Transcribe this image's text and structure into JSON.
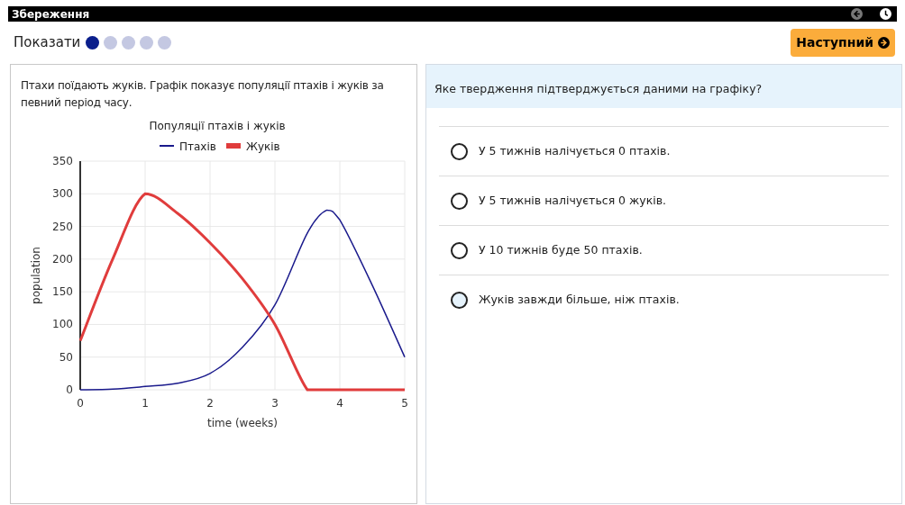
{
  "window": {
    "title": "Збереження"
  },
  "toolbar": {
    "show_label": "Показати",
    "progress": [
      {
        "selected": true
      },
      {
        "selected": false
      },
      {
        "selected": false
      },
      {
        "selected": false
      },
      {
        "selected": false
      }
    ],
    "next_button": "Наступний"
  },
  "passage": {
    "text": "Птахи поїдають жуків. Графік показує популяції птахів і жуків за певний період часу.",
    "chart_data": {
      "type": "line",
      "title": "Популяції птахів і жуків",
      "xlabel": "time (weeks)",
      "ylabel": "population",
      "x": [
        0,
        0.5,
        1,
        1.5,
        2,
        2.5,
        3,
        3.5,
        3.8,
        4,
        4.5,
        5
      ],
      "series": [
        {
          "name": "Птахів",
          "color": "#1a1a8c",
          "values": [
            0,
            1,
            5,
            10,
            25,
            65,
            130,
            240,
            275,
            260,
            160,
            50
          ]
        },
        {
          "name": "Жуків",
          "color": "#e03c3c",
          "values": [
            75,
            200,
            300,
            270,
            225,
            170,
            100,
            0,
            0,
            0,
            0,
            0
          ]
        }
      ],
      "grid": true,
      "legend": true,
      "xlim": [
        0,
        5
      ],
      "ylim": [
        0,
        350
      ],
      "xticks": [
        0,
        1,
        2,
        3,
        4,
        5
      ],
      "yticks": [
        0,
        50,
        100,
        150,
        200,
        250,
        300,
        350
      ]
    }
  },
  "question": {
    "prompt": "Яке твердження підтверджується даними на графіку?",
    "options": [
      {
        "label": "У 5 тижнів налічується 0 птахів.",
        "selected": false,
        "hovered": false
      },
      {
        "label": "У 5 тижнів налічується 0 жуків.",
        "selected": false,
        "hovered": false
      },
      {
        "label": "У 10 тижнів буде 50 птахів.",
        "selected": false,
        "hovered": false
      },
      {
        "label": "Жуків завжди більше, ніж птахів.",
        "selected": false,
        "hovered": true
      }
    ]
  }
}
